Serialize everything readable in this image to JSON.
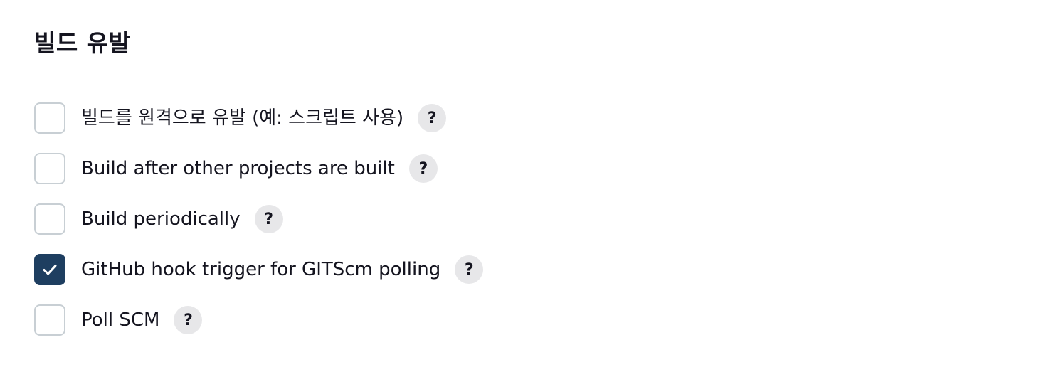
{
  "section": {
    "title": "빌드 유발"
  },
  "options": [
    {
      "label": "빌드를 원격으로 유발 (예: 스크립트 사용)",
      "checked": false,
      "help": "?"
    },
    {
      "label": "Build after other projects are built",
      "checked": false,
      "help": "?"
    },
    {
      "label": "Build periodically",
      "checked": false,
      "help": "?"
    },
    {
      "label": "GitHub hook trigger for GITScm polling",
      "checked": true,
      "help": "?"
    },
    {
      "label": "Poll SCM",
      "checked": false,
      "help": "?"
    }
  ],
  "colors": {
    "checkbox_checked": "#1e3e60",
    "checkbox_border": "#c8cfd4",
    "help_bg": "#e7e7e9",
    "text": "#14141f"
  },
  "icons": {
    "check": "check-icon",
    "help": "help-icon"
  }
}
